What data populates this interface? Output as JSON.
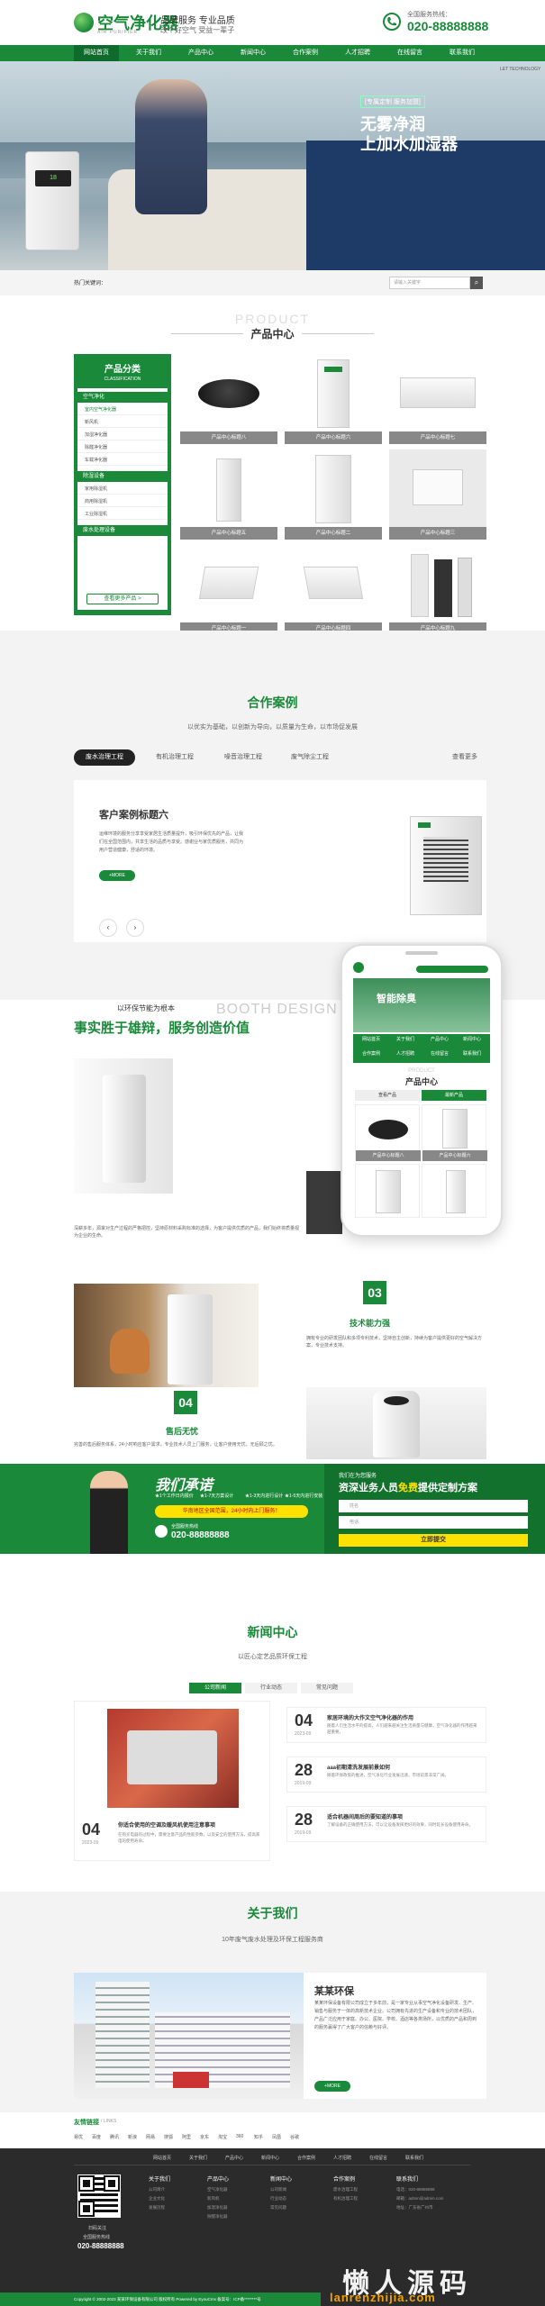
{
  "header": {
    "logo_text": "空气净化器",
    "logo_sub": "AIR PURIFIER",
    "slogan_top": "品牌服务   专业品质",
    "slogan_bottom": "改个好空气 受益一辈子",
    "phone_label": "全国服务热线：",
    "phone_number": "020-88888888"
  },
  "nav": {
    "items": [
      "网站首页",
      "关于我们",
      "产品中心",
      "新闻中心",
      "合作案例",
      "人才招聘",
      "在线留言",
      "联系我们"
    ],
    "active_index": 0
  },
  "banner": {
    "tag": "[专属定制 服务加盟]",
    "title_line1": "无雾净润",
    "title_line2": "上加水加湿器",
    "corner_text": "LET TECHNOLOGY",
    "device_screen": "18"
  },
  "search": {
    "hot_label": "热门关键词：",
    "placeholder": "请输入关键字",
    "button_glyph": "⌕"
  },
  "products": {
    "en_title": "PRODUCT",
    "cn_title": "产品中心",
    "category_title": "产品分类",
    "category_en": "CLASSIFICATION",
    "groups": [
      {
        "title": "空气净化",
        "items": [
          "室内空气净化器",
          "新风机",
          "加湿净化器",
          "除醛净化器",
          "车载净化器"
        ]
      },
      {
        "title": "除湿设备",
        "items": [
          "家用除湿机",
          "商用除湿机",
          "工业除湿机"
        ]
      },
      {
        "title": "废水处理设备",
        "items": []
      }
    ],
    "more_label": "查看更多产品 >",
    "items": [
      {
        "caption": "产品中心标题八",
        "kind": "round"
      },
      {
        "caption": "产品中心标题六",
        "kind": "tall"
      },
      {
        "caption": "产品中心标题七",
        "kind": "wall"
      },
      {
        "caption": "产品中心标题五",
        "kind": "tower"
      },
      {
        "caption": "产品中心标题二",
        "kind": "tall"
      },
      {
        "caption": "产品中心标题三",
        "kind": "wallbox"
      },
      {
        "caption": "产品中心标题一",
        "kind": "portable"
      },
      {
        "caption": "产品中心标题四",
        "kind": "portable"
      },
      {
        "caption": "产品中心标题九",
        "kind": "towers"
      }
    ]
  },
  "cases": {
    "title": "合作案例",
    "subtitle": "以优实为基础，以创新为导向，以质量为生命，以市场促发展",
    "tabs": [
      "废水治理工程",
      "有机治理工程",
      "噪音治理工程",
      "废气除尘工程"
    ],
    "active_tab": 0,
    "more_label": "查看更多",
    "card_title": "客户案例标题六",
    "card_text": "运维环境的服务分享享受家居生活质量提升，吸引环保优先的产品，让我们在全国范围内，共享生活的品质与享受。感谢业与家优质服务，共同为用户营造健康，舒适的环境。",
    "card_more": "+MORE",
    "prev": "‹",
    "next": "›"
  },
  "advantage": {
    "small_label": "以环保节能为根本",
    "en_title": "BOOTH DESIGN INNOVA",
    "title": "事实胜于雄辩，服务创造价值",
    "para1": "深耕多年，源掌对生产过程的严格把控，坚持原材料采购标准的选择，为客户提供优质的产品，我们始终将质量视为企业的生命。",
    "block3_num": "03",
    "block3_title": "技术能力强",
    "block3_text": "拥有专业的研发团队和多项专利技术，坚持自主创新，持续为客户提供更好的空气解决方案，专业技术支持。",
    "block4_num": "04",
    "block4_title": "售后无忧",
    "block4_text": "完善的售后服务体系，24小时响应客户需求，专业技术人员上门服务，让客户使用无忧，无后顾之忧。"
  },
  "phone_mockup": {
    "banner_text": "智能除臭",
    "nav": [
      "网站首页",
      "关于我们",
      "产品中心",
      "新闻中心",
      "合作案例",
      "人才招聘",
      "在线留言",
      "联系我们"
    ],
    "section_en": "PRODUCT",
    "section_cn": "产品中心",
    "tabs": [
      "查看产品",
      "最新产品"
    ],
    "captions": [
      "产品中心标题八",
      "产品中心标题六"
    ]
  },
  "promise": {
    "title": "我们承诺",
    "lines": [
      "★1个工作日内报价",
      "★1-7天方案设计",
      "★1-3天内进行设计",
      "★1-5天内进行安装"
    ],
    "pill": "华南地区全国范围，24小时内上门服务！",
    "phone_label": "全国服务热线",
    "phone": "020-88888888",
    "form_tag": "我们在为您服务",
    "form_title_a": "资深业务人员",
    "form_title_b": "免费",
    "form_title_c": "提供定制方案",
    "name_placeholder": "姓名",
    "phone_placeholder": "电话",
    "submit": "立即提交"
  },
  "news": {
    "title": "新闻中心",
    "subtitle": "以匠心定艺品质环保工程",
    "tabs": [
      "公司新闻",
      "行业动态",
      "常见问题"
    ],
    "active_tab": 0,
    "featured": {
      "day": "04",
      "date": "2023-09",
      "title": "你适合使用的空调及暖风机使用注意事项",
      "desc": "在购买电器的过程中，需要注意产品的性能参数，以及安全的使用方法，提高家电的使用寿命。"
    },
    "items": [
      {
        "day": "04",
        "date": "2023-09",
        "title": "家居环境的大作文空气净化器的作用",
        "desc": "随着人们生活水平的提高，人们越来越关注生活质量与健康，空气净化器的作用越来越重要。"
      },
      {
        "day": "28",
        "date": "2019-09",
        "title": "aaa初期清洗发展前景如何",
        "desc": "随着环保政策的推进，空气净化行业发展迅速，市场前景非常广阔。"
      },
      {
        "day": "28",
        "date": "2019-09",
        "title": "适合机器间周后的要知道的事项",
        "desc": "了解设备的正确使用方法，可以让设备发挥更好的效果，同时延长设备使用寿命。"
      }
    ]
  },
  "about": {
    "title": "关于我们",
    "subtitle": "10年废气废水处理及环保工程服务商",
    "name": "某某环保",
    "text": "某某环保设备有限公司成立于多年前，是一家专业从事空气净化设备研发、生产、销售与服务于一体的高新技术企业。公司拥有先进的生产设备和专业的技术团队，产品广泛应用于家庭、办公、医院、学校、酒店等各类场所，以优质的产品和周到的服务赢得了广大客户的信赖与好评。",
    "more": "+MORE"
  },
  "links": {
    "title": "友情链接",
    "title_en": "/ LINKS",
    "items": [
      "易优",
      "百度",
      "腾讯",
      "新浪",
      "网易",
      "搜狐",
      "阿里",
      "京东",
      "淘宝",
      "360",
      "知乎",
      "凤凰",
      "谷歌"
    ]
  },
  "footer": {
    "nav": [
      "网站首页",
      "关于我们",
      "产品中心",
      "新闻中心",
      "合作案例",
      "人才招聘",
      "在线留言",
      "联系我们"
    ],
    "qr_label1": "扫码关注",
    "qr_label2": "全国服务热线",
    "qr_phone": "020-88888888",
    "cols": [
      {
        "title": "关于我们",
        "items": [
          "公司简介",
          "企业文化",
          "发展历程"
        ]
      },
      {
        "title": "产品中心",
        "items": [
          "空气净化器",
          "新风机",
          "加湿净化器",
          "除醛净化器"
        ]
      },
      {
        "title": "新闻中心",
        "items": [
          "公司新闻",
          "行业动态",
          "常见问题"
        ]
      },
      {
        "title": "合作案例",
        "items": [
          "废水治理工程",
          "有机治理工程"
        ]
      },
      {
        "title": "联系我们",
        "items": [
          "电话：020-88888888",
          "邮箱：admin@admin.com",
          "地址：广东省广州市"
        ]
      }
    ],
    "copyright": "Copyright © 2002-2023 某某环保设备有限公司 版权所有 Powered by EyouCms    备案号：ICP备********号",
    "watermark": "懒人源码",
    "watermark_url": "lanrenzhijia.com"
  }
}
